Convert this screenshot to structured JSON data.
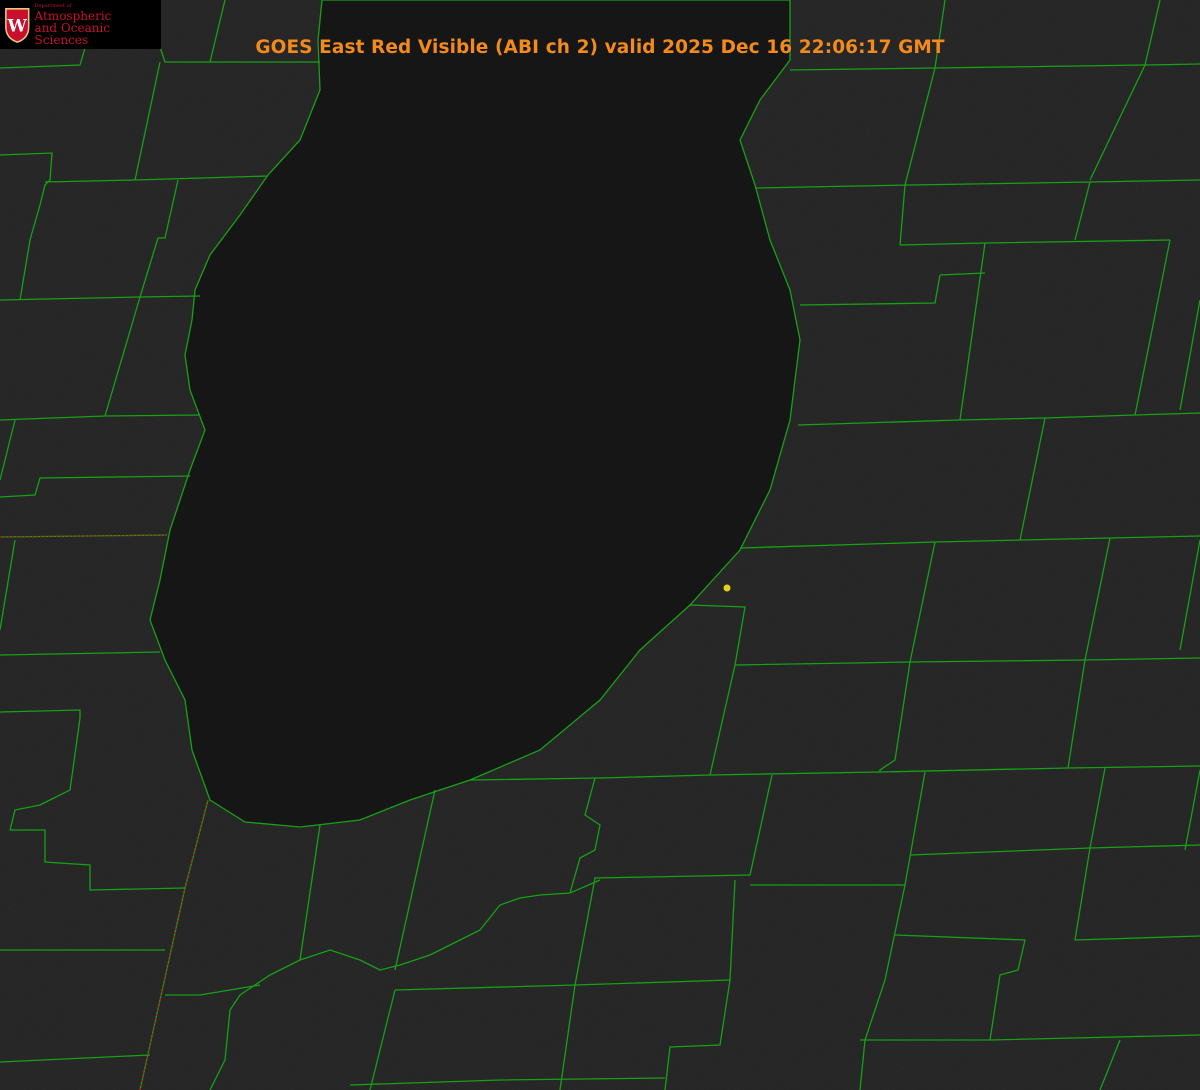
{
  "title": "GOES East Red Visible (ABI ch 2) valid 2025 Dec 16 22:06:17 GMT",
  "logo": {
    "department": "Department of",
    "line1": "Atmospheric",
    "line2": "and Oceanic Sciences",
    "crest_letter": "W"
  },
  "colors": {
    "background": "#1f1f1f",
    "lake": "#161616",
    "county_lines": "#16a016",
    "shoreline_dots": "#d01010",
    "title": "#f28a1c",
    "logo_text": "#c8102e",
    "marker": "#e6d21e"
  },
  "icons": [
    "uw-crest-icon",
    "location-marker-icon"
  ]
}
